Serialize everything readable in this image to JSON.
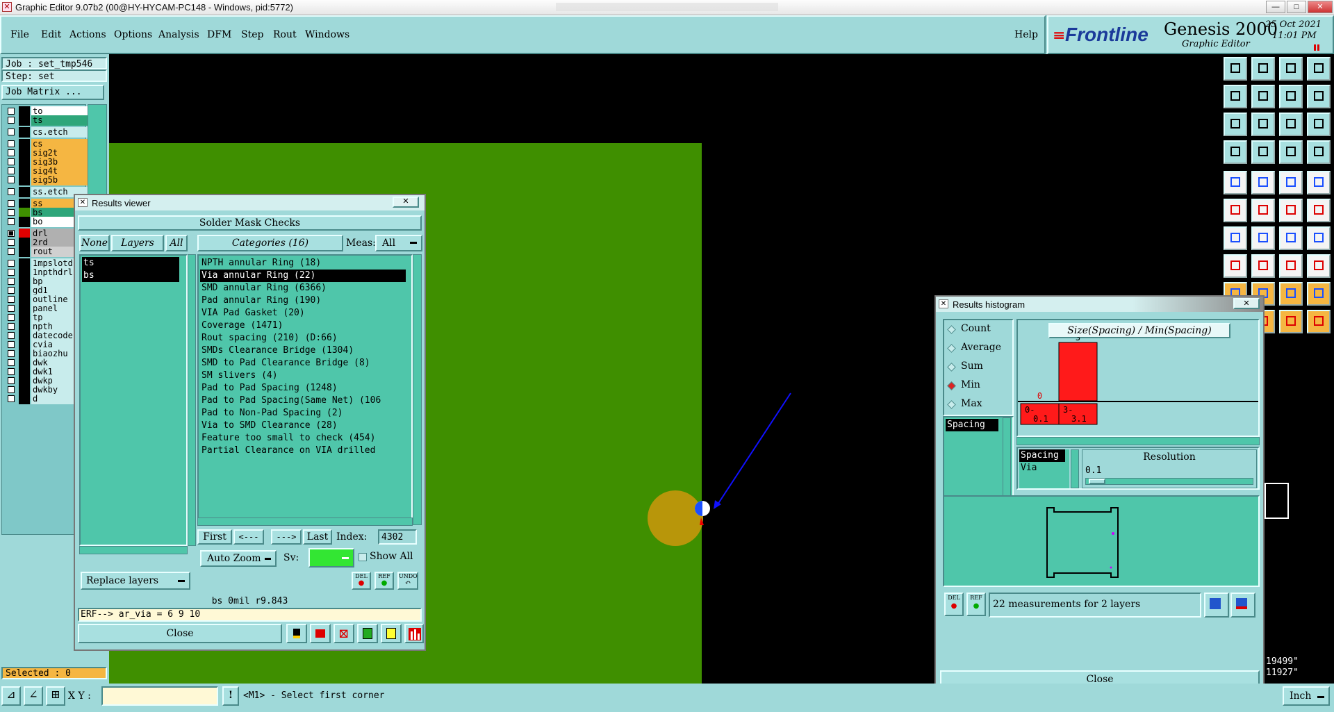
{
  "window": {
    "title": "Graphic Editor 9.07b2 (00@HY-HYCAM-PC148 - Windows, pid:5772)"
  },
  "menu": {
    "items": [
      "File",
      "Edit",
      "Actions",
      "Options",
      "Analysis",
      "DFM",
      "Step",
      "Rout",
      "Windows"
    ],
    "help": "Help"
  },
  "brand": {
    "logo": "Frontline",
    "product": "Genesis 2000",
    "subtitle": "Graphic Editor",
    "date": "25 Oct 2021",
    "time": "11:01 PM"
  },
  "job": {
    "job_label": "Job : set_tmp546",
    "step_label": "Step: set",
    "matrix_button": "Job Matrix ..."
  },
  "layers": [
    {
      "name": "to",
      "color": "#ffffff",
      "checked": false
    },
    {
      "name": "ts",
      "color": "#2ea67a",
      "checked": false
    },
    {
      "name": "cs.etch",
      "color": "#c8ecec",
      "checked": false
    },
    {
      "name": "cs",
      "color": "#f5b642",
      "checked": false
    },
    {
      "name": "sig2t",
      "color": "#f5b642",
      "checked": false
    },
    {
      "name": "sig3b",
      "color": "#f5b642",
      "checked": false
    },
    {
      "name": "sig4t",
      "color": "#f5b642",
      "checked": false
    },
    {
      "name": "sig5b",
      "color": "#f5b642",
      "checked": false
    },
    {
      "name": "ss.etch",
      "color": "#c8ecec",
      "checked": false
    },
    {
      "name": "ss",
      "color": "#f5b642",
      "checked": false
    },
    {
      "name": "bs",
      "color": "#2ea67a",
      "checked": false,
      "swatch": "#3f8f00"
    },
    {
      "name": "bo",
      "color": "#ffffff",
      "checked": false
    },
    {
      "name": "drl",
      "color": "#b0b0b0",
      "checked": true,
      "swatch": "#e00000"
    },
    {
      "name": "2rd",
      "color": "#b0b0b0",
      "checked": false
    },
    {
      "name": "rout",
      "color": "#d0d0d0",
      "checked": false
    },
    {
      "name": "1mpslotdr",
      "color": "#c8ecec",
      "checked": false
    },
    {
      "name": "1npthdrl",
      "color": "#c8ecec",
      "checked": false
    },
    {
      "name": "bp",
      "color": "#c8ecec",
      "checked": false
    },
    {
      "name": "gd1",
      "color": "#c8ecec",
      "checked": false
    },
    {
      "name": "outline",
      "color": "#c8ecec",
      "checked": false
    },
    {
      "name": "panel",
      "color": "#c8ecec",
      "checked": false
    },
    {
      "name": "tp",
      "color": "#c8ecec",
      "checked": false
    },
    {
      "name": "npth",
      "color": "#c8ecec",
      "checked": false
    },
    {
      "name": "datecode-",
      "color": "#c8ecec",
      "checked": false
    },
    {
      "name": "cvia",
      "color": "#c8ecec",
      "checked": false
    },
    {
      "name": "biaozhu",
      "color": "#c8ecec",
      "checked": false
    },
    {
      "name": "dwk",
      "color": "#c8ecec",
      "checked": false
    },
    {
      "name": "dwk1",
      "color": "#c8ecec",
      "checked": false
    },
    {
      "name": "dwkp",
      "color": "#c8ecec",
      "checked": false
    },
    {
      "name": "dwkby",
      "color": "#c8ecec",
      "checked": false
    },
    {
      "name": "d",
      "color": "#c8ecec",
      "checked": false
    }
  ],
  "selected": "Selected : 0",
  "results_viewer": {
    "title": "Results viewer",
    "heading": "Solder Mask Checks",
    "none_btn": "None",
    "layers_btn": "Layers",
    "all_btn": "All",
    "categories_label": "Categories (16)",
    "meas_label": "Meas:",
    "meas_value": "All",
    "layer_list": [
      "ts",
      "bs"
    ],
    "categories": [
      "NPTH annular Ring (18)",
      "Via annular Ring (22)",
      "SMD annular Ring (6366)",
      "Pad annular Ring (190)",
      "VIA Pad Gasket (20)",
      "Coverage (1471)",
      "Rout spacing (210)        (D:66)",
      "SMDs Clearance Bridge (1304)",
      "SMD to Pad Clearance Bridge (8)",
      "SM slivers (4)",
      "Pad to Pad Spacing (1248)",
      "Pad to Pad Spacing(Same Net) (106",
      "Pad to Non-Pad Spacing (2)",
      "Via to SMD Clearance (28)",
      "Feature too small to check (454)",
      "Partial Clearance on VIA drilled"
    ],
    "selected_index": 1,
    "first": "First",
    "prev": "<---",
    "next": "--->",
    "last": "Last",
    "index_label": "Index:",
    "index_value": "4302",
    "auto_zoom": "Auto Zoom",
    "sv_label": "Sv:",
    "show_all": "Show All",
    "replace_layers": "Replace layers",
    "status": "bs 0mil  r9.843",
    "erf": "ERF--> ar_via = 6 9 10",
    "close": "Close",
    "del": "DEL",
    "ref": "REF",
    "undo": "UNDO"
  },
  "histogram": {
    "title": "Results histogram",
    "modes": [
      "Count",
      "Average",
      "Sum",
      "Min",
      "Max"
    ],
    "selected_mode": "Min",
    "chart_title": "Size(Spacing) / Min(Spacing)",
    "list1": [
      "Spacing"
    ],
    "list2": [
      "Spacing",
      "Via"
    ],
    "resolution_label": "Resolution",
    "resolution_value": "0.1",
    "bins": [
      {
        "label1": "0-",
        "label2": "0.1",
        "count": 0
      },
      {
        "label1": "3-",
        "label2": "3.1",
        "count": 3
      }
    ],
    "bar_color": "#ff1a1a",
    "summary": "22 measurements for 2 layers",
    "close": "Close",
    "del": "DEL",
    "ref": "REF"
  },
  "bottom": {
    "xy_label": "X Y :",
    "prompt": "<M1> - Select first corner",
    "unit": "Inch",
    "coord1": "19499\"",
    "coord2": "11927\""
  }
}
